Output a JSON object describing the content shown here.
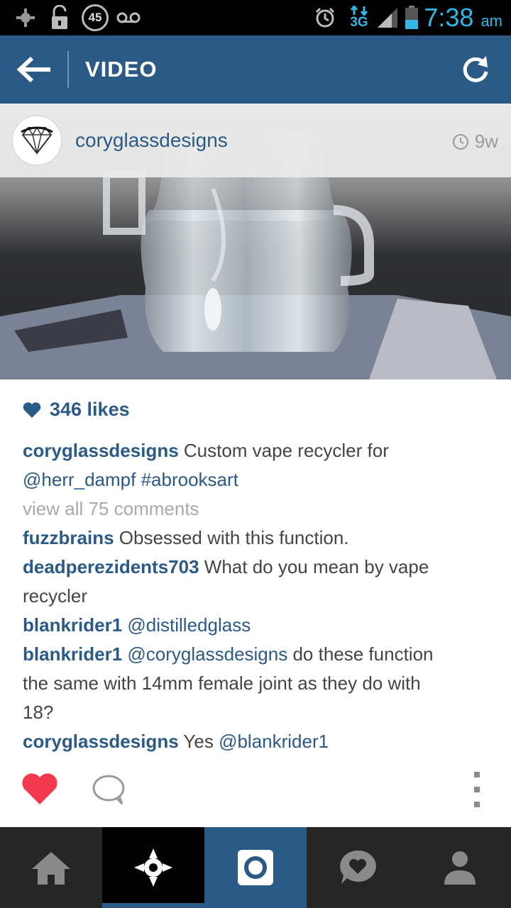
{
  "status_bar": {
    "notification_count": "45",
    "time": "7:38",
    "ampm": "am",
    "network": "3G",
    "icons": [
      "usb-debug-icon",
      "unlock-icon",
      "notification-count-icon",
      "voicemail-icon",
      "alarm-icon",
      "data-arrows-icon",
      "signal-icon",
      "battery-icon"
    ]
  },
  "header": {
    "title": "VIDEO",
    "back_icon": "arrow-left-icon",
    "refresh_icon": "refresh-icon"
  },
  "post": {
    "username": "coryglassdesigns",
    "time_ago": "9w",
    "likes_count": "346 likes",
    "caption": {
      "user": "coryglassdesigns",
      "text": " Custom vape recycler for",
      "mention": "@herr_dampf",
      "hashtag": " #abrooksart"
    },
    "view_all": "view all 75 comments",
    "comments": [
      {
        "user": "fuzzbrains",
        "text": " Obsessed with this function."
      },
      {
        "user": "deadperezidents703",
        "text": " What do you mean by vape",
        "cont": "recycler"
      },
      {
        "user": "blankrider1",
        "mention": " @distilledglass"
      },
      {
        "user": "blankrider1",
        "mention": " @coryglassdesigns",
        "text": " do these function",
        "cont": "the same with 14mm female joint as they do with",
        "cont2": "18?"
      },
      {
        "user": "coryglassdesigns",
        "text": " Yes ",
        "mention": "@blankrider1"
      }
    ]
  },
  "actions": {
    "like_color": "#f2394f",
    "icons": [
      "heart-icon",
      "comment-icon",
      "more-icon"
    ]
  },
  "bottom_nav": {
    "items": [
      "home-icon",
      "explore-icon",
      "camera-icon",
      "activity-icon",
      "profile-icon"
    ],
    "active": "explore-icon"
  },
  "colors": {
    "brand": "#2b5a87",
    "status_time": "#34b5e5"
  }
}
